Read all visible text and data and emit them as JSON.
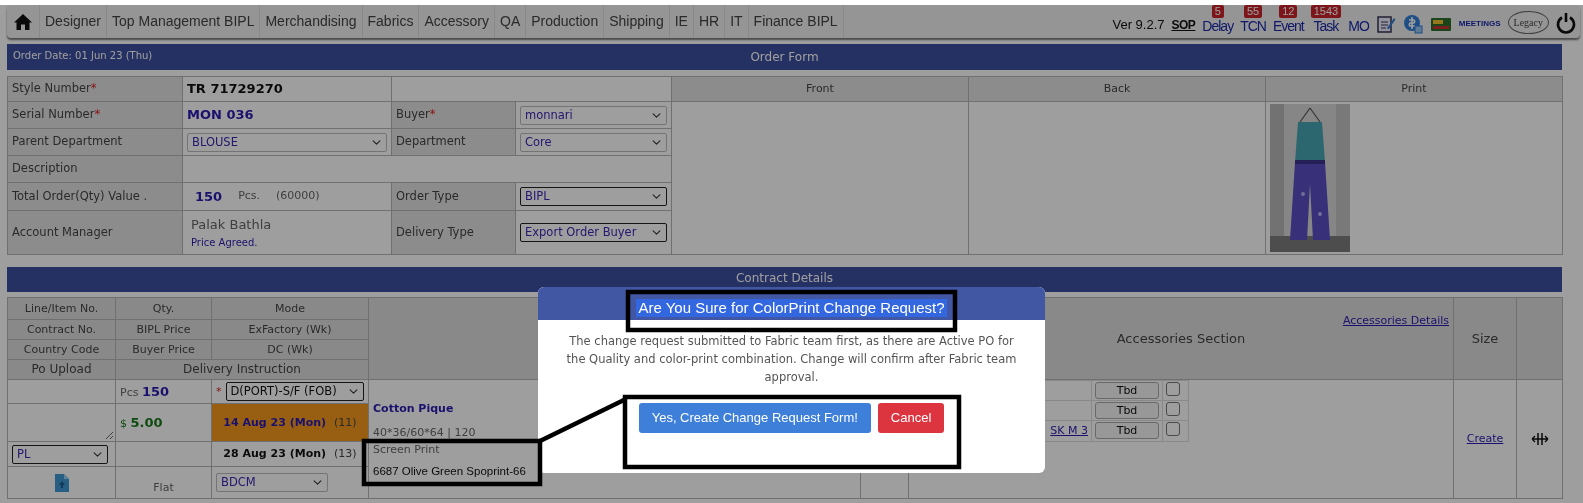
{
  "nav": {
    "items": [
      {
        "label": "Designer"
      },
      {
        "label": "Top Management BIPL"
      },
      {
        "label": "Merchandising"
      },
      {
        "label": "Fabrics"
      },
      {
        "label": "Accessory"
      },
      {
        "label": "QA"
      },
      {
        "label": "Production"
      },
      {
        "label": "Shipping"
      },
      {
        "label": "IE"
      },
      {
        "label": "HR"
      },
      {
        "label": "IT"
      },
      {
        "label": "Finance BIPL"
      }
    ],
    "version": "Ver 9.2.7",
    "sop": "SOP",
    "links": [
      {
        "label": "Delay",
        "badge": "5"
      },
      {
        "label": "TCN",
        "badge": "55"
      },
      {
        "label": "Event",
        "badge": "12"
      },
      {
        "label": "Task",
        "badge": "1543"
      },
      {
        "label": "MO"
      }
    ],
    "meetings": "MEETINGS",
    "legacy": "Legacy"
  },
  "order_form": {
    "title": "Order Form",
    "order_date_label": "Order Date:",
    "order_date": "01 Jun 23 (Thu)",
    "style_number": {
      "label": "Style Number",
      "mark": "*",
      "value": "TR 71729270"
    },
    "serial_number": {
      "label": "Serial Number",
      "mark": "*",
      "value": "MON 036"
    },
    "buyer": {
      "label": "Buyer",
      "mark": "*",
      "value": "monnari"
    },
    "parent_department": {
      "label": "Parent Department",
      "value": "BLOUSE"
    },
    "department": {
      "label": "Department",
      "value": "Core"
    },
    "description": {
      "label": "Description"
    },
    "total_order": {
      "label": "Total Order(Qty) Value .",
      "qty": "150",
      "unit": "Pcs.",
      "value": "(60000)"
    },
    "order_type": {
      "label": "Order Type",
      "value": "BIPL"
    },
    "account_manager": {
      "label": "Account Manager",
      "value": "Palak Bathla",
      "note": "Price Agreed."
    },
    "delivery_type": {
      "label": "Delivery Type",
      "value": "Export Order Buyer"
    },
    "views": [
      {
        "label": "Front"
      },
      {
        "label": "Back"
      },
      {
        "label": "Print",
        "kind": "picture"
      }
    ]
  },
  "contract": {
    "title": "Contract Details",
    "header_rows": [
      [
        "Line/Item No.",
        "Qty.",
        "Mode"
      ],
      [
        "Contract No.",
        "BIPL Price",
        "ExFactory (Wk)"
      ],
      [
        "Country Code",
        "Buyer Price",
        "DC (Wk)"
      ]
    ],
    "po_upload": "Po Upload",
    "delivery_instruction": "Delivery Instruction",
    "accessories_title": "Accessories Section",
    "accessories_link": "Accessories Details",
    "size_title": "Size",
    "line": {
      "qty_unit": "Pcs",
      "qty": "150",
      "mode_mark": "*",
      "mode": "D(PORT)-S/F (FOB)",
      "currency": "$",
      "price": "5.00",
      "exfactory": {
        "date": "14 Aug 23 (Mon)",
        "weeks": "(11)",
        "highlighted": true
      },
      "dc": {
        "date": "28 Aug 23 (Mon)",
        "weeks": "(13)",
        "highlighted": false
      },
      "country": "PL",
      "packing": "Flat",
      "delivery_instruction": "BDCM",
      "fabric": "Cotton Pique",
      "construction": "40*36/60*64 |  120",
      "print_type": "Screen Print",
      "color_print": "6687 Olive Green Spoprint-66",
      "accessories": [
        {
          "status": "Tbd",
          "checked": false
        },
        {
          "status": "Tbd",
          "checked": false
        },
        {
          "name": "SK M 3",
          "status": "Tbd",
          "checked": false
        }
      ],
      "size_link": "Create"
    }
  },
  "modal": {
    "title": "Are You Sure for ColorPrint Change Request?",
    "title_selected": true,
    "message": "The change request submitted to Fabric team first, as there are Active PO for the Quality and color-print combination. Change will confirm after Fabric team approval.",
    "buttons": [
      {
        "label": "Yes, Create Change Request Form!",
        "kind": "primary"
      },
      {
        "label": "Cancel",
        "kind": "danger"
      }
    ]
  }
}
